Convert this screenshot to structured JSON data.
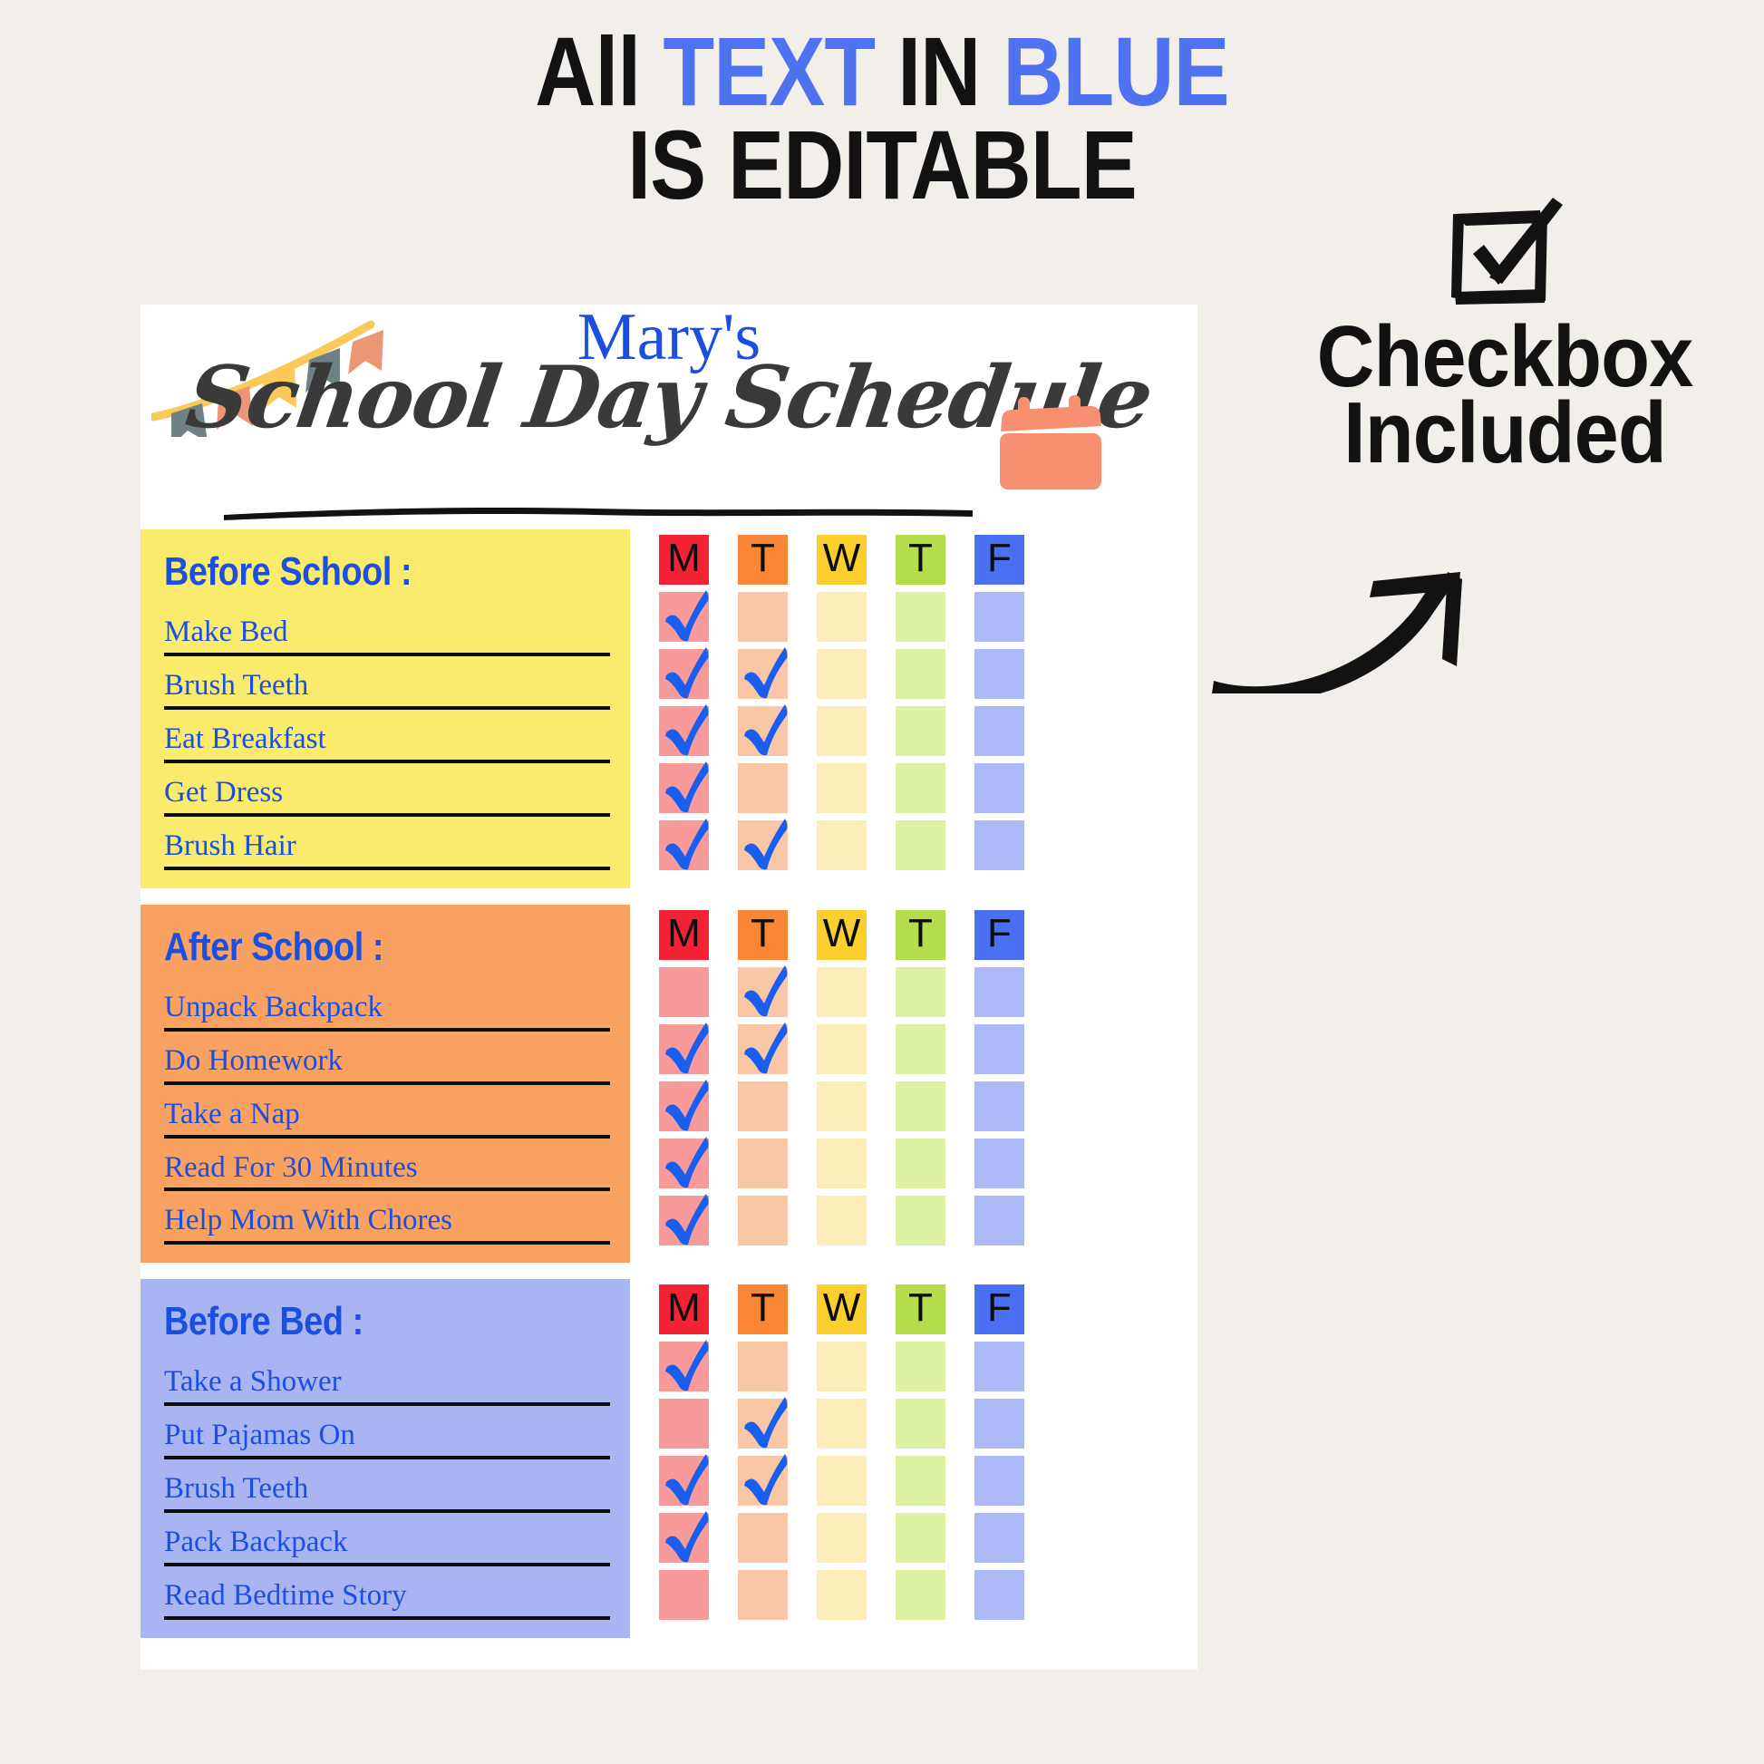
{
  "banner": {
    "line1_part1": "All ",
    "line1_part2": "TEXT",
    "line1_part3": " IN ",
    "line1_part4": "BLUE",
    "line2": "IS EDITABLE"
  },
  "callout": {
    "icon": "checkbox-checked-icon",
    "line1": "Checkbox",
    "line2": "Included",
    "arrow": "curved-arrow-icon"
  },
  "card": {
    "owner_name": "Mary's",
    "title": "School Day Schedule",
    "calendar_icon": "calendar-icon",
    "bunting_icon": "bunting-flags-icon"
  },
  "day_columns": [
    {
      "label": "M",
      "head_color": "#f42235",
      "cell_color": "#f79a99"
    },
    {
      "label": "T",
      "head_color": "#f98634",
      "cell_color": "#f9c6a6"
    },
    {
      "label": "W",
      "head_color": "#fbd02e",
      "cell_color": "#fceeb9"
    },
    {
      "label": "T",
      "head_color": "#b4dc4c",
      "cell_color": "#dcf2a0"
    },
    {
      "label": "F",
      "head_color": "#4a6ff0",
      "cell_color": "#adbaf7"
    }
  ],
  "check_color": "#1a5ef0",
  "sections": [
    {
      "id": "before-school",
      "title": "Before School :",
      "panel_color": "#fbeb6c",
      "tasks": [
        {
          "label": "Make Bed",
          "checks": [
            true,
            false,
            false,
            false,
            false
          ]
        },
        {
          "label": "Brush Teeth",
          "checks": [
            true,
            true,
            false,
            false,
            false
          ]
        },
        {
          "label": "Eat Breakfast",
          "checks": [
            true,
            true,
            false,
            false,
            false
          ]
        },
        {
          "label": "Get Dress",
          "checks": [
            true,
            false,
            false,
            false,
            false
          ]
        },
        {
          "label": "Brush Hair",
          "checks": [
            true,
            true,
            false,
            false,
            false
          ]
        }
      ]
    },
    {
      "id": "after-school",
      "title": "After School :",
      "panel_color": "#f9a161",
      "tasks": [
        {
          "label": "Unpack Backpack",
          "checks": [
            false,
            true,
            false,
            false,
            false
          ]
        },
        {
          "label": "Do Homework",
          "checks": [
            true,
            true,
            false,
            false,
            false
          ]
        },
        {
          "label": "Take a Nap",
          "checks": [
            true,
            false,
            false,
            false,
            false
          ]
        },
        {
          "label": "Read For 30 Minutes",
          "checks": [
            true,
            false,
            false,
            false,
            false
          ]
        },
        {
          "label": "Help Mom With Chores",
          "checks": [
            true,
            false,
            false,
            false,
            false
          ]
        }
      ]
    },
    {
      "id": "before-bed",
      "title": "Before Bed :",
      "panel_color": "#a9b4f2",
      "tasks": [
        {
          "label": "Take a Shower",
          "checks": [
            true,
            false,
            false,
            false,
            false
          ]
        },
        {
          "label": "Put Pajamas On",
          "checks": [
            false,
            true,
            false,
            false,
            false
          ]
        },
        {
          "label": "Brush Teeth",
          "checks": [
            true,
            true,
            false,
            false,
            false
          ]
        },
        {
          "label": "Pack Backpack",
          "checks": [
            true,
            false,
            false,
            false,
            false
          ]
        },
        {
          "label": "Read Bedtime Story",
          "checks": [
            false,
            false,
            false,
            false,
            false
          ]
        }
      ]
    }
  ],
  "colors": {
    "background": "#f2eee9",
    "card": "#ffffff",
    "editable_blue": "#1a4fe0",
    "banner_blue": "#4f72f0",
    "ink": "#121212",
    "script_gray": "#3a3a3a",
    "calendar_coral": "#f79070"
  }
}
